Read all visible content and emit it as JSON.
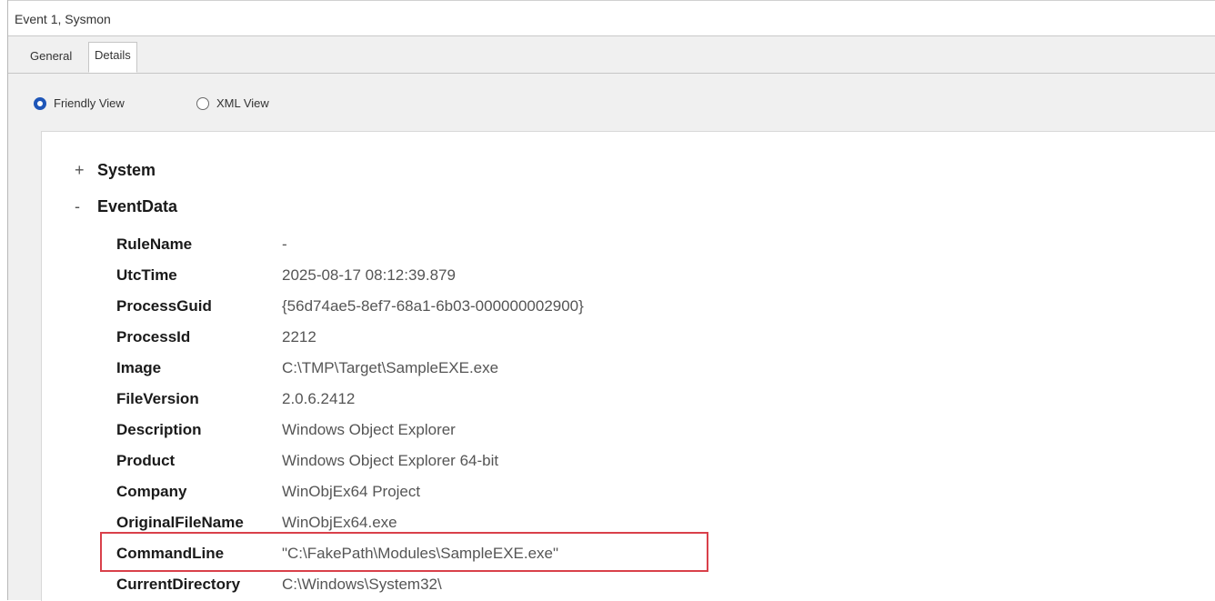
{
  "window": {
    "title": "Event 1, Sysmon"
  },
  "tabs": [
    {
      "label": "General"
    },
    {
      "label": "Details"
    }
  ],
  "view_options": {
    "friendly": "Friendly View",
    "xml": "XML View",
    "selected": "Friendly View"
  },
  "tree": {
    "system": {
      "sign": "+",
      "label": "System"
    },
    "eventdata": {
      "sign": "-",
      "label": "EventData"
    }
  },
  "fields": [
    {
      "key": "RuleName",
      "value": "-"
    },
    {
      "key": "UtcTime",
      "value": "2025-08-17 08:12:39.879"
    },
    {
      "key": "ProcessGuid",
      "value": "{56d74ae5-8ef7-68a1-6b03-000000002900}"
    },
    {
      "key": "ProcessId",
      "value": "2212"
    },
    {
      "key": "Image",
      "value": "C:\\TMP\\Target\\SampleEXE.exe"
    },
    {
      "key": "FileVersion",
      "value": "2.0.6.2412"
    },
    {
      "key": "Description",
      "value": "Windows Object Explorer"
    },
    {
      "key": "Product",
      "value": "Windows Object Explorer 64-bit"
    },
    {
      "key": "Company",
      "value": "WinObjEx64 Project"
    },
    {
      "key": "OriginalFileName",
      "value": "WinObjEx64.exe"
    },
    {
      "key": "CommandLine",
      "value": "\"C:\\FakePath\\Modules\\SampleEXE.exe\""
    },
    {
      "key": "CurrentDirectory",
      "value": "C:\\Windows\\System32\\"
    }
  ],
  "colors": {
    "highlight": "#d9404a",
    "radio_selected": "#1e56b8"
  }
}
